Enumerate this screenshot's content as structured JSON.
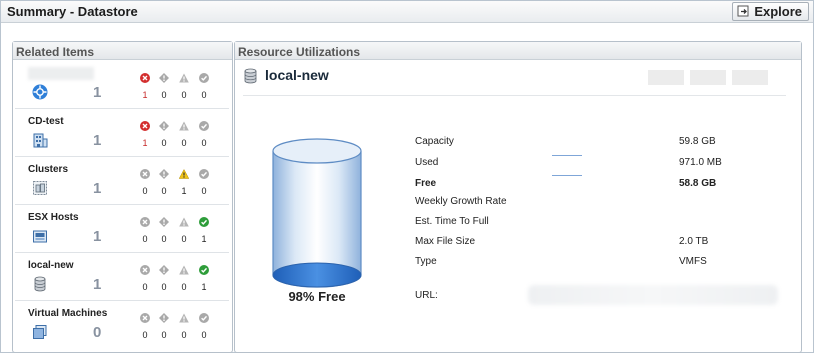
{
  "window": {
    "title": "Summary - Datastore",
    "explore_label": "Explore"
  },
  "related_items": {
    "header": "Related Items",
    "rows": [
      {
        "name": "",
        "icon": "datacenter-icon",
        "count": "1",
        "statuses": [
          "1",
          "0",
          "0",
          "0"
        ],
        "critical_icon": "critical-icon",
        "last_icon": "normal-icon"
      },
      {
        "name": "CD-test",
        "icon": "building-icon",
        "count": "1",
        "statuses": [
          "1",
          "0",
          "0",
          "0"
        ],
        "critical_icon": "critical-icon",
        "last_icon": "normal-icon"
      },
      {
        "name": "Clusters",
        "icon": "cluster-icon",
        "count": "1",
        "statuses": [
          "0",
          "0",
          "1",
          "0"
        ],
        "critical_icon": "gray-x-icon",
        "last_icon": "normal-icon"
      },
      {
        "name": "ESX Hosts",
        "icon": "host-icon",
        "count": "1",
        "statuses": [
          "0",
          "0",
          "0",
          "1"
        ],
        "critical_icon": "gray-x-icon",
        "last_icon": "ok-icon"
      },
      {
        "name": "local-new",
        "icon": "datastore-icon",
        "count": "1",
        "statuses": [
          "0",
          "0",
          "0",
          "1"
        ],
        "critical_icon": "gray-x-icon",
        "last_icon": "ok-icon"
      },
      {
        "name": "Virtual Machines",
        "icon": "vm-icon",
        "count": "0",
        "statuses": [
          "0",
          "0",
          "0",
          "0"
        ],
        "critical_icon": "gray-x-icon",
        "last_icon": "normal-icon"
      }
    ]
  },
  "resource": {
    "header": "Resource Utilizations",
    "datastore_name": "local-new",
    "free_caption": "98% Free",
    "free_fraction": 0.98,
    "stats": [
      {
        "label": "Capacity",
        "value": "59.8 GB",
        "bold": false
      },
      {
        "label": "Used",
        "value": "971.0 MB",
        "bold": false
      },
      {
        "label": "Free",
        "value": "58.8 GB",
        "bold": true
      },
      {
        "label": "Weekly Growth Rate",
        "value": "",
        "bold": false
      },
      {
        "label": "Est. Time To Full",
        "value": "",
        "bold": false
      },
      {
        "label": "Max File Size",
        "value": "2.0 TB",
        "bold": false
      },
      {
        "label": "Type",
        "value": "VMFS",
        "bold": false
      }
    ],
    "url_label": "URL:"
  },
  "colors": {
    "critical": "#d32f2f",
    "warning": "#f0c419",
    "ok": "#2e9d3a",
    "neutral": "#a9a9a9",
    "cylinder_fill": "#2f74d0"
  }
}
